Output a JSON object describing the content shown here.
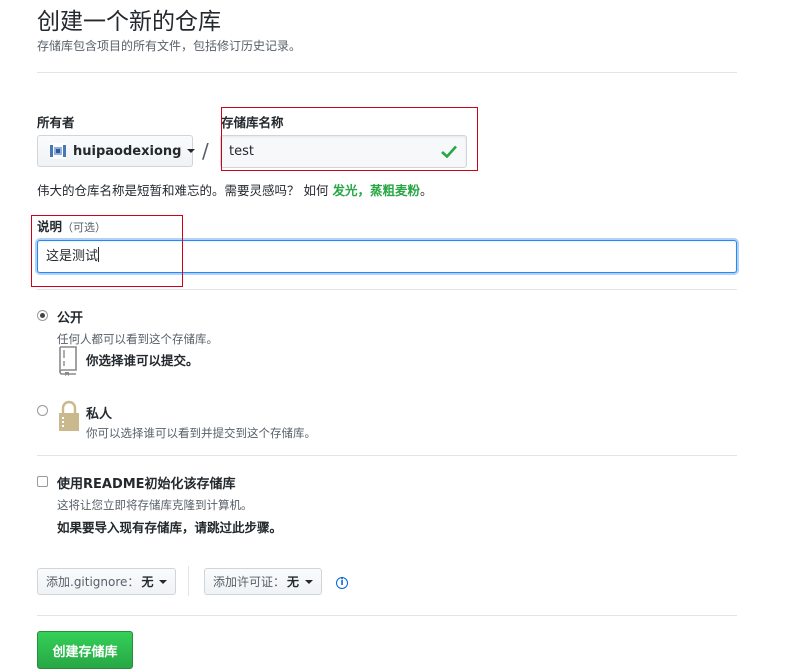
{
  "page": {
    "title": "创建一个新的仓库",
    "subtitle": "存储库包含项目的所有文件，包括修订历史记录。"
  },
  "owner": {
    "label": "所有者",
    "name": "huipaodexiong"
  },
  "repo_name": {
    "label": "存储库名称",
    "value": "test"
  },
  "hint": {
    "prefix": "伟大的仓库名称是短暂和难忘的。需要灵感吗？ 如何 ",
    "suggestion": "发光，蒸粗麦粉",
    "suffix": "。"
  },
  "description": {
    "label": "说明",
    "optional": "（可选）",
    "value": "这是测试"
  },
  "visibility": {
    "selected": "public",
    "public": {
      "title": "公开",
      "note": "任何人都可以看到这个存储库。",
      "extra": "你选择谁可以提交。"
    },
    "private": {
      "title": "私人",
      "note": "你可以选择谁可以看到并提交到这个存储库。"
    }
  },
  "readme": {
    "checked": false,
    "title": "使用README初始化该存储库",
    "note": "这将让您立即将存储库克隆到计算机。",
    "extra": "如果要导入现有存储库，请跳过此步骤。"
  },
  "gitignore": {
    "label": "添加.gitignore：",
    "value": "无"
  },
  "license": {
    "label": "添加许可证：",
    "value": "无"
  },
  "info_icon": "i",
  "create_button": "创建存储库",
  "colors": {
    "accent_green": "#28a745",
    "focus_blue": "#2188ff",
    "highlight_red": "#d0021b"
  }
}
